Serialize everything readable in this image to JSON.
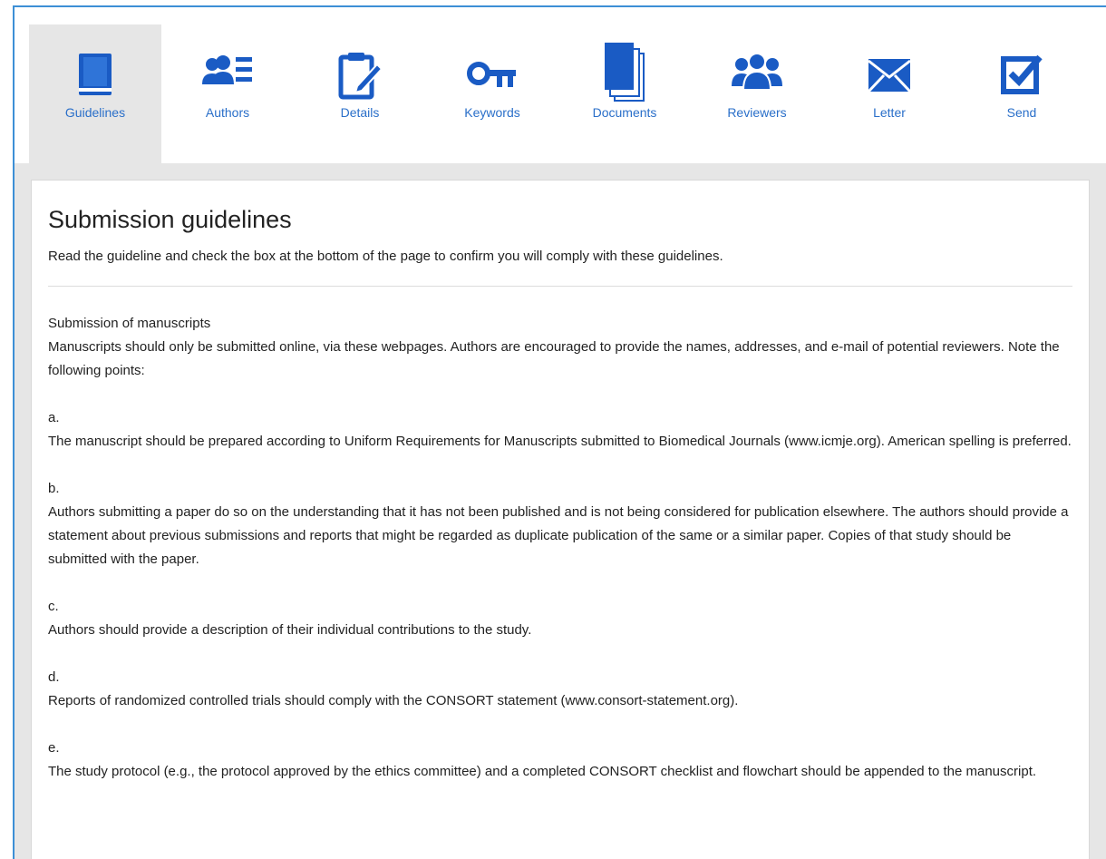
{
  "colors": {
    "accent": "#1a5bc4",
    "link": "#2a6fc9",
    "frame_border": "#3d8fd6"
  },
  "tabs": [
    {
      "label": "Guidelines",
      "icon": "book-icon",
      "active": true
    },
    {
      "label": "Authors",
      "icon": "authors-list-icon",
      "active": false
    },
    {
      "label": "Details",
      "icon": "clipboard-edit-icon",
      "active": false
    },
    {
      "label": "Keywords",
      "icon": "key-icon",
      "active": false
    },
    {
      "label": "Documents",
      "icon": "documents-stack-icon",
      "active": false
    },
    {
      "label": "Reviewers",
      "icon": "users-group-icon",
      "active": false
    },
    {
      "label": "Letter",
      "icon": "envelope-icon",
      "active": false
    },
    {
      "label": "Send",
      "icon": "checkbox-send-icon",
      "active": false
    }
  ],
  "main": {
    "title": "Submission guidelines",
    "intro": "Read the guideline and check the box at the bottom of the page to confirm you will comply with these guidelines.",
    "section_title": "Submission of manuscripts",
    "section_text": "Manuscripts should only be submitted online, via these webpages. Authors are encouraged to provide the names, addresses, and e-mail of potential reviewers. Note the following points:",
    "items": [
      {
        "letter": "a.",
        "text": "The manuscript should be prepared according to Uniform Requirements for Manuscripts submitted to Biomedical Journals (www.icmje.org). American spelling is preferred."
      },
      {
        "letter": "b.",
        "text": "Authors submitting a paper do so on the understanding that it has not been published and is not being considered for publication elsewhere. The authors should provide a statement about previous submissions and reports that might be regarded as duplicate publication of the same or a similar paper. Copies of that study should be submitted with the paper."
      },
      {
        "letter": "c.",
        "text": "Authors should provide a description of their individual contributions to the study."
      },
      {
        "letter": "d.",
        "text": "Reports of randomized controlled trials should comply with the CONSORT statement (www.consort-statement.org)."
      },
      {
        "letter": "e.",
        "text": "The study protocol (e.g., the protocol approved by the ethics committee) and a completed CONSORT checklist and flowchart should be appended to the manuscript."
      }
    ]
  }
}
